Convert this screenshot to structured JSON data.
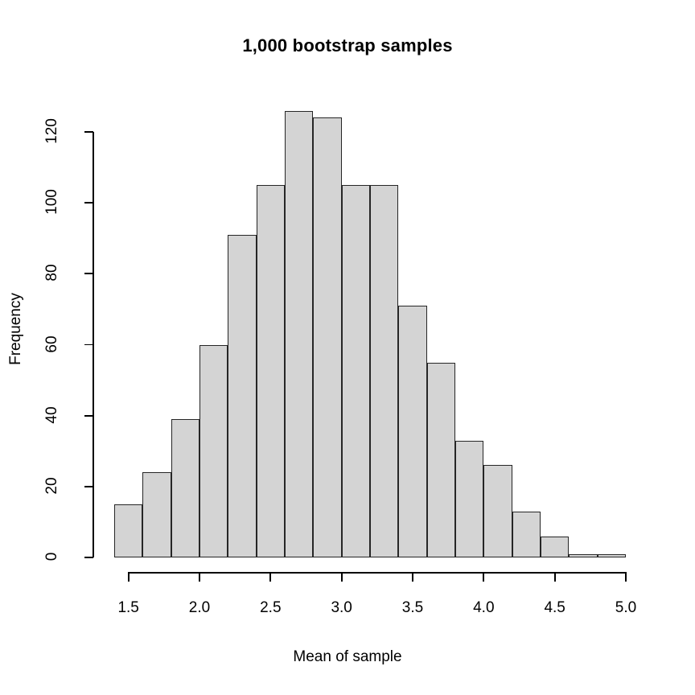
{
  "chart_data": {
    "type": "bar",
    "title": "1,000 bootstrap samples",
    "xlabel": "Mean of sample",
    "ylabel": "Frequency",
    "grid": false,
    "legend": null,
    "bin_width": 0.2,
    "bin_edges": [
      1.4,
      1.6,
      1.8,
      2.0,
      2.2,
      2.4,
      2.6,
      2.8,
      3.0,
      3.2,
      3.4,
      3.6,
      3.8,
      4.0,
      4.2,
      4.4,
      4.6,
      4.8,
      5.0
    ],
    "categories": [
      "1.4-1.6",
      "1.6-1.8",
      "1.8-2.0",
      "2.0-2.2",
      "2.2-2.4",
      "2.4-2.6",
      "2.6-2.8",
      "2.8-3.0",
      "3.0-3.2",
      "3.2-3.4",
      "3.4-3.6",
      "3.6-3.8",
      "3.8-4.0",
      "4.0-4.2",
      "4.2-4.4",
      "4.4-4.6",
      "4.6-4.8",
      "4.8-5.0"
    ],
    "values": [
      15,
      24,
      39,
      60,
      91,
      105,
      126,
      124,
      105,
      105,
      71,
      55,
      33,
      26,
      13,
      6,
      1,
      1
    ],
    "xlim": [
      1.4,
      5.0
    ],
    "ylim": [
      0,
      126
    ],
    "xticks": [
      1.5,
      2.0,
      2.5,
      3.0,
      3.5,
      4.0,
      4.5,
      5.0
    ],
    "xtick_labels": [
      "1.5",
      "2.0",
      "2.5",
      "3.0",
      "3.5",
      "4.0",
      "4.5",
      "5.0"
    ],
    "yticks": [
      0,
      20,
      40,
      60,
      80,
      100,
      120
    ],
    "ytick_labels": [
      "0",
      "20",
      "40",
      "60",
      "80",
      "100",
      "120"
    ],
    "bar_fill_color": "#d4d4d4",
    "bar_border_color": "#262626",
    "total_samples": 1000
  }
}
